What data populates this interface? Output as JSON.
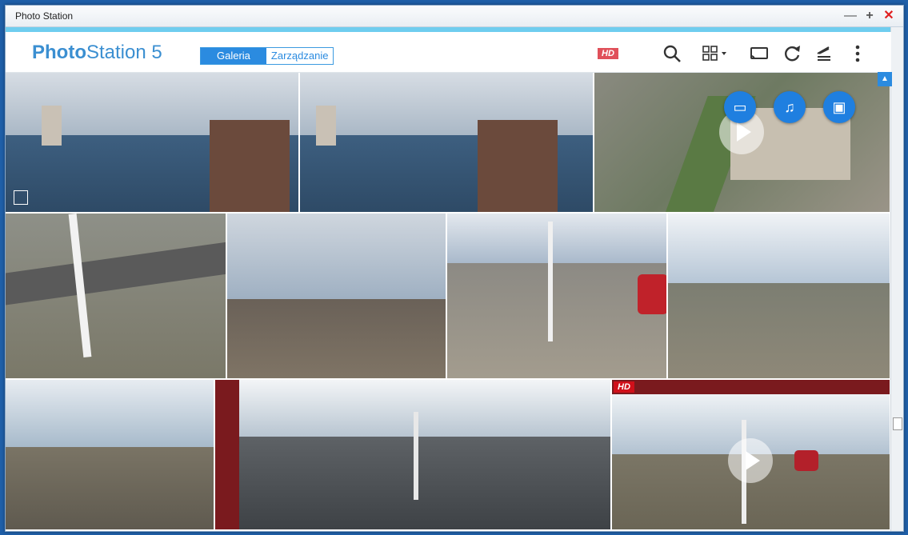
{
  "window": {
    "title": "Photo Station"
  },
  "header": {
    "logo_bold": "Photo",
    "logo_light": "Station 5",
    "tabs": [
      {
        "label": "Galeria",
        "active": true
      },
      {
        "label": "Zarządzanie",
        "active": false
      }
    ]
  },
  "toolbar_icons": [
    "search-icon",
    "view-mode-icon",
    "cast-icon",
    "refresh-icon",
    "upload-icon",
    "more-icon"
  ],
  "badges": {
    "hd": "HD"
  },
  "colors": {
    "accent": "#2b8be0",
    "hd_badge": "#d0101a",
    "progress": "#6fcdef"
  }
}
